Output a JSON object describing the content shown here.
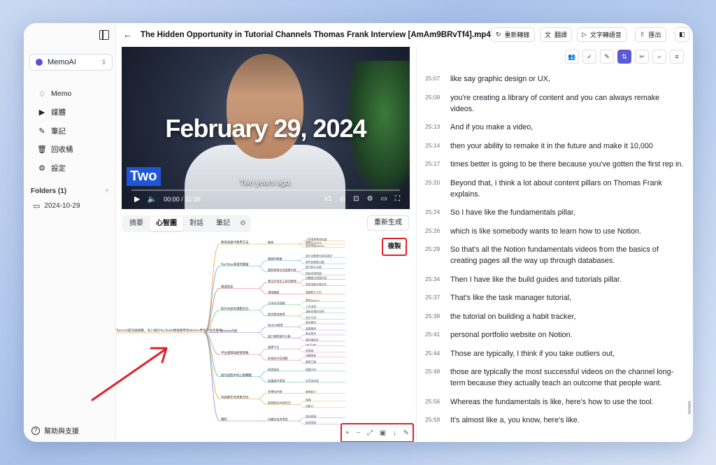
{
  "app": {
    "workspace": "MemoAI"
  },
  "sidebar": {
    "items": [
      {
        "icon": "lightbulb-icon",
        "label": "Memo"
      },
      {
        "icon": "play-square-icon",
        "label": "媒體"
      },
      {
        "icon": "pencil-icon",
        "label": "筆記"
      },
      {
        "icon": "trash-icon",
        "label": "回收桶"
      },
      {
        "icon": "gear-icon",
        "label": "設定"
      }
    ],
    "folders_label": "Folders (1)",
    "folders": [
      "2024-10-29"
    ],
    "help_label": "幫助與支援"
  },
  "header": {
    "title": "The Hidden Opportunity in Tutorial Channels Thomas Frank Interview [AmAm9BRvTf4].mp4",
    "buttons": {
      "retranscribe": "重新轉錄",
      "translate": "翻譯",
      "tts": "文字轉語音",
      "export": "匯出"
    }
  },
  "video": {
    "overlay_title": "February 29, 2024",
    "chip": "Two",
    "subtitle": "Two years ago,",
    "time": "00:00 / 31:38",
    "speed": "x1",
    "progress": 0
  },
  "panel": {
    "tabs": [
      "摘要",
      "心智圖",
      "對話",
      "筆記"
    ],
    "active_tab": "心智圖",
    "regenerate": "重新生成",
    "copy": "複製"
  },
  "mindmap": {
    "root": "Tutorial成功與挑戰，深入探討YouTube頻道教學及Notion學習平台的重要",
    "branches": [
      {
        "label": "教育與替代教學方法",
        "children": [
          {
            "label": "機會",
            "leaves": [
              "人們渴望學習知識",
              "選擇YouTube",
              "適合學習Notion"
            ]
          }
        ]
      },
      {
        "label": "YouTube頻道的機會",
        "children": [
          {
            "label": "轉變的動機",
            "leaves": [
              "用戶對教學內容有需求",
              "熱門的教學主題"
            ]
          },
          {
            "label": "重新創建及改進舊內容",
            "leaves": [
              "提升影片品質",
              "提高內容價值"
            ]
          }
        ]
      },
      {
        "label": "頻道成長",
        "children": [
          {
            "label": "專注於特定工具的教學",
            "leaves": [
              "持續產出相關內容",
              "與其他創作者合作"
            ]
          },
          {
            "label": "領域擴展",
            "leaves": [
              "規劃影片方向"
            ]
          }
        ]
      },
      {
        "label": "影片內容的規劃方向",
        "children": [
          {
            "label": "分享成功經驗",
            "leaves": [
              "學習Notion",
              "工作流程"
            ]
          },
          {
            "label": "提供實用教學",
            "leaves": [
              "清晰易懂的說明",
              "逐步引導"
            ]
          }
        ]
      },
      {
        "label": "Notion內容",
        "children": [
          {
            "label": "Notion教學",
            "leaves": [
              "基本概念",
              "進階應用"
            ]
          },
          {
            "label": "進行實際操作示範",
            "leaves": [
              "範本製作",
              "資料庫設定"
            ]
          }
        ]
      },
      {
        "label": "平台選擇與經營策略",
        "children": [
          {
            "label": "選擇平台",
            "leaves": [
              "YouTube",
              "部落格"
            ]
          },
          {
            "label": "創意與內容規劃",
            "leaves": [
              "持續更新",
              "觀眾互動"
            ]
          }
        ]
      },
      {
        "label": "創作過程中的心態轉變",
        "children": [
          {
            "label": "接受變化",
            "leaves": [
              "調整方向"
            ]
          },
          {
            "label": "從錯誤中學習",
            "leaves": [
              "反思與成長"
            ]
          }
        ]
      },
      {
        "label": "內容創作的未來方向",
        "children": [
          {
            "label": "多樣化內容",
            "leaves": [
              "教學影片"
            ]
          },
          {
            "label": "探索新的內容形式",
            "leaves": [
              "直播",
              "短影片"
            ]
          }
        ]
      },
      {
        "label": "總結",
        "children": [
          {
            "label": "持續成長與學習",
            "leaves": [
              "保持熱情",
              "創造價值"
            ]
          }
        ]
      }
    ]
  },
  "transcript": [
    {
      "t": "25:07",
      "text": "like say graphic design or UX,"
    },
    {
      "t": "25:09",
      "text": "you're creating a library of content and you can always remake videos."
    },
    {
      "t": "25:13",
      "text": "And if you make a video,"
    },
    {
      "t": "25:14",
      "text": "then your ability to remake it in the future and make it 10,000"
    },
    {
      "t": "25:17",
      "text": "times better is going to be there because you've gotten the first rep in."
    },
    {
      "t": "25:20",
      "text": "Beyond that, I think a lot about content pillars on Thomas Frank explains."
    },
    {
      "t": "25:24",
      "text": "So I have like the fundamentals pillar,"
    },
    {
      "t": "25:26",
      "text": "which is like somebody wants to learn how to use Notion."
    },
    {
      "t": "25:29",
      "text": "So that's all the Notion fundamentals videos from the basics of creating pages all the way up through databases."
    },
    {
      "t": "25:34",
      "text": "Then I have like the build guides and tutorials pillar."
    },
    {
      "t": "25:37",
      "text": "That's like the task manager tutorial,"
    },
    {
      "t": "25:39",
      "text": "the tutorial on building a habit tracker,"
    },
    {
      "t": "25:41",
      "text": "personal portfolio website on Notion."
    },
    {
      "t": "25:44",
      "text": "Those are typically, I think if you take outliers out,"
    },
    {
      "t": "25:49",
      "text": "those are typically the most successful videos on the channel long-term because they actually teach an outcome that people want."
    },
    {
      "t": "25:56",
      "text": "Whereas the fundamentals is like, here's how to use the tool."
    },
    {
      "t": "25:59",
      "text": "It's almost like a, you know, here's like."
    }
  ],
  "colors": {
    "accent": "#5b5bd6",
    "highlight": "#e0202a"
  }
}
